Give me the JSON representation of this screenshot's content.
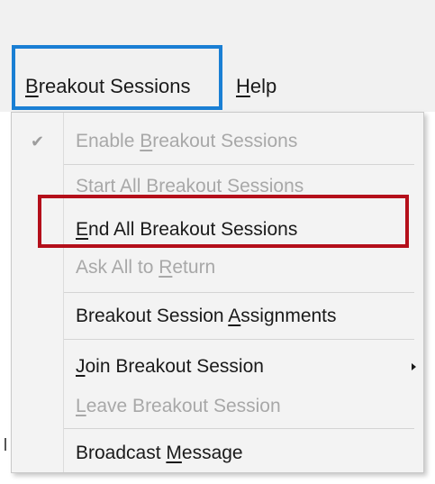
{
  "menubar": {
    "breakout": {
      "pre": "",
      "accel": "B",
      "post": "reakout Sessions"
    },
    "help": {
      "pre": "",
      "accel": "H",
      "post": "elp"
    }
  },
  "dropdown": {
    "check_glyph": "✔",
    "items": [
      {
        "pre": "Enable ",
        "accel": "B",
        "post": "reakout Sessions",
        "checked": true,
        "enabled": false
      },
      {
        "pre": "Start All Breakout Sessions",
        "accel": "",
        "post": "",
        "checked": false,
        "enabled": false
      },
      {
        "pre": "",
        "accel": "E",
        "post": "nd All Breakout Sessions",
        "checked": false,
        "enabled": true
      },
      {
        "pre": "Ask All to ",
        "accel": "R",
        "post": "eturn",
        "checked": false,
        "enabled": false
      },
      {
        "pre": "Breakout Session ",
        "accel": "A",
        "post": "ssignments",
        "checked": false,
        "enabled": true
      },
      {
        "pre": "",
        "accel": "J",
        "post": "oin Breakout Session",
        "checked": false,
        "enabled": true,
        "submenu": true
      },
      {
        "pre": "",
        "accel": "L",
        "post": "eave Breakout Session",
        "checked": false,
        "enabled": false
      },
      {
        "pre": "Broadcast ",
        "accel": "M",
        "post": "essage",
        "checked": false,
        "enabled": true
      }
    ]
  },
  "colors": {
    "selection_highlight": "#1a7fd4",
    "callout": "#b40f1a",
    "disabled_text": "#a8a8a8"
  }
}
